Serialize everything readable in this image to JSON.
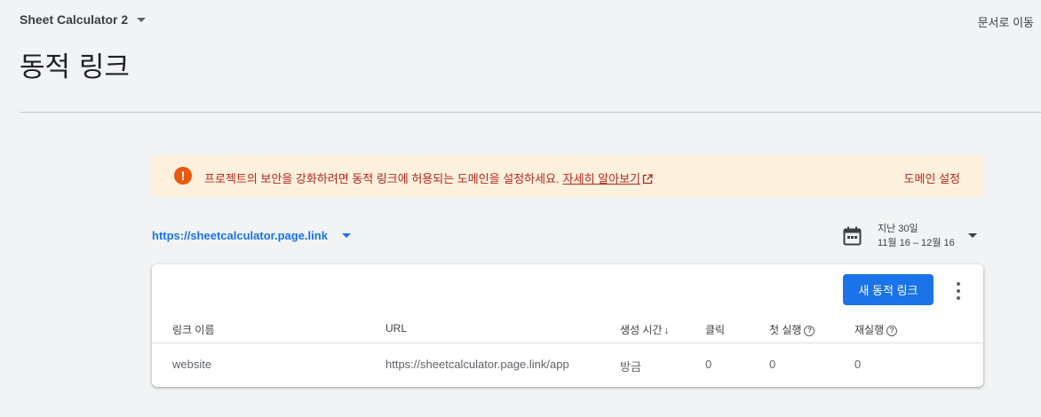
{
  "header": {
    "project_name": "Sheet Calculator 2",
    "docs_link": "문서로 이동",
    "page_title": "동적 링크"
  },
  "warning_banner": {
    "message": "프로젝트의 보안을 강화하려면 동적 링크에 허용되는 도메인을 설정하세요.",
    "learn_more": "자세히 알아보기",
    "action": "도메인 설정",
    "colors": {
      "background": "#fdf0dc",
      "text": "#b3261e",
      "icon": "#e8590c"
    }
  },
  "domain_selector": {
    "value": "https://sheetcalculator.page.link"
  },
  "date_range": {
    "label": "지난 30일",
    "range": "11월 16 – 12월 16"
  },
  "table": {
    "new_button_label": "새 동적 링크",
    "columns": [
      "링크 이름",
      "URL",
      "생성 시간",
      "클릭",
      "첫 실행",
      "재실행"
    ],
    "rows": [
      {
        "name": "website",
        "url": "https://sheetcalculator.page.link/app",
        "created": "방금",
        "clicks": "0",
        "first_opens": "0",
        "reopens": "0"
      }
    ]
  },
  "accent_color": "#1a73e8"
}
